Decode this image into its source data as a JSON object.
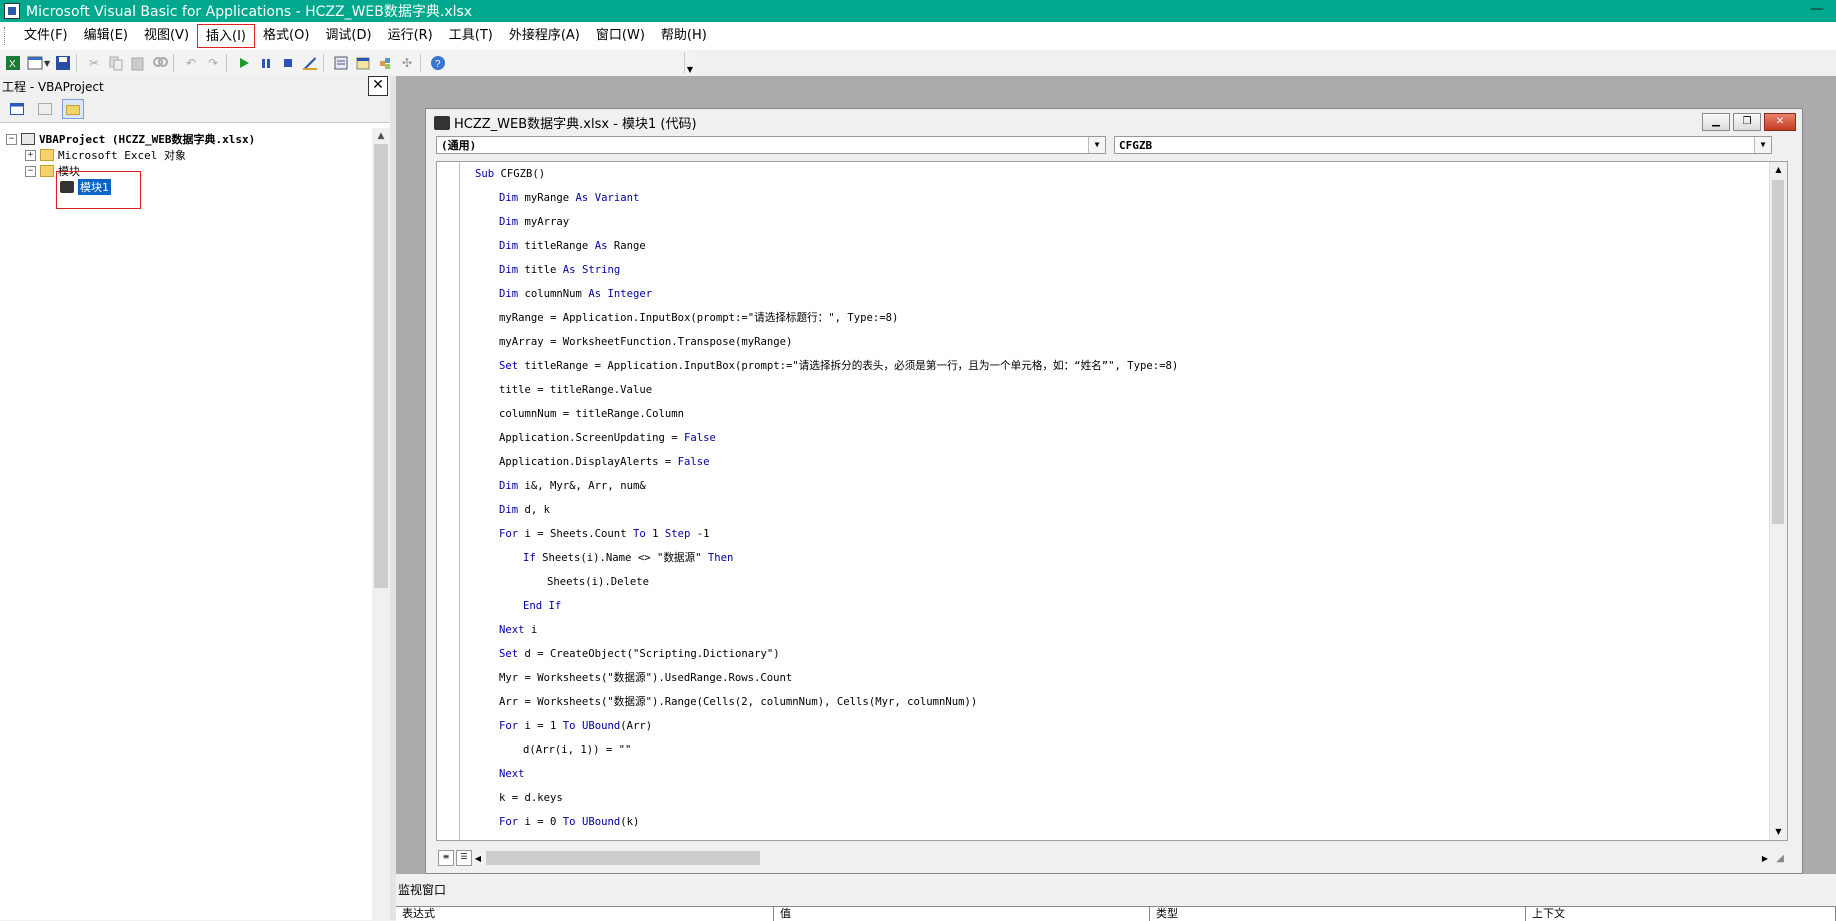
{
  "window": {
    "title": "Microsoft Visual Basic for Applications - HCZZ_WEB数据字典.xlsx",
    "minimize_glyph": "—"
  },
  "menu": [
    {
      "label": "文件(F)"
    },
    {
      "label": "编辑(E)"
    },
    {
      "label": "视图(V)"
    },
    {
      "label": "插入(I)",
      "highlighted": true
    },
    {
      "label": "格式(O)"
    },
    {
      "label": "调试(D)"
    },
    {
      "label": "运行(R)"
    },
    {
      "label": "工具(T)"
    },
    {
      "label": "外接程序(A)"
    },
    {
      "label": "窗口(W)"
    },
    {
      "label": "帮助(H)"
    }
  ],
  "toolbar": {
    "icons": [
      "excel-icon",
      "insert-userform-icon",
      "save-icon",
      "cut-icon",
      "copy-icon",
      "paste-icon",
      "find-icon",
      "undo-icon",
      "redo-icon",
      "run-icon",
      "break-icon",
      "reset-icon",
      "design-mode-icon",
      "project-explorer-icon",
      "properties-icon",
      "object-browser-icon",
      "toolbox-icon",
      "help-icon"
    ]
  },
  "project": {
    "title": "工程 - VBAProject",
    "close_glyph": "✕",
    "tree": {
      "root": "VBAProject (HCZZ_WEB数据字典.xlsx)",
      "excel_objects": "Microsoft Excel 对象",
      "modules_folder": "模块",
      "module1": "模块1"
    }
  },
  "codewindow": {
    "title": "HCZZ_WEB数据字典.xlsx - 模块1 (代码)",
    "object_dropdown": "(通用)",
    "proc_dropdown": "CFGZB",
    "lines": [
      {
        "indent": 0,
        "parts": [
          {
            "t": "Sub",
            "kw": true
          },
          {
            "t": " CFGZB()"
          }
        ]
      },
      {
        "indent": 1,
        "parts": [
          {
            "t": "Dim",
            "kw": true
          },
          {
            "t": " myRange "
          },
          {
            "t": "As",
            "kw": true
          },
          {
            "t": " "
          },
          {
            "t": "Variant",
            "kw": true
          }
        ]
      },
      {
        "indent": 1,
        "parts": [
          {
            "t": "Dim",
            "kw": true
          },
          {
            "t": " myArray"
          }
        ]
      },
      {
        "indent": 1,
        "parts": [
          {
            "t": "Dim",
            "kw": true
          },
          {
            "t": " titleRange "
          },
          {
            "t": "As",
            "kw": true
          },
          {
            "t": " Range"
          }
        ]
      },
      {
        "indent": 1,
        "parts": [
          {
            "t": "Dim",
            "kw": true
          },
          {
            "t": " title "
          },
          {
            "t": "As",
            "kw": true
          },
          {
            "t": " "
          },
          {
            "t": "String",
            "kw": true
          }
        ]
      },
      {
        "indent": 1,
        "parts": [
          {
            "t": "Dim",
            "kw": true
          },
          {
            "t": " columnNum "
          },
          {
            "t": "As",
            "kw": true
          },
          {
            "t": " "
          },
          {
            "t": "Integer",
            "kw": true
          }
        ]
      },
      {
        "indent": 1,
        "parts": [
          {
            "t": "myRange = Application.InputBox(prompt:=\"请选择标题行：\", Type:=8)"
          }
        ]
      },
      {
        "indent": 1,
        "parts": [
          {
            "t": "myArray = WorksheetFunction.Transpose(myRange)"
          }
        ]
      },
      {
        "indent": 1,
        "parts": [
          {
            "t": "Set",
            "kw": true
          },
          {
            "t": " titleRange = Application.InputBox(prompt:=\"请选择拆分的表头，必须是第一行，且为一个单元格，如：“姓名”\", Type:=8)"
          }
        ]
      },
      {
        "indent": 1,
        "parts": [
          {
            "t": "title = titleRange.Value"
          }
        ]
      },
      {
        "indent": 1,
        "parts": [
          {
            "t": "columnNum = titleRange.Column"
          }
        ]
      },
      {
        "indent": 1,
        "parts": [
          {
            "t": "Application.ScreenUpdating = "
          },
          {
            "t": "False",
            "kw": true
          }
        ]
      },
      {
        "indent": 1,
        "parts": [
          {
            "t": "Application.DisplayAlerts = "
          },
          {
            "t": "False",
            "kw": true
          }
        ]
      },
      {
        "indent": 1,
        "parts": [
          {
            "t": "Dim",
            "kw": true
          },
          {
            "t": " i&, Myr&, Arr, num&"
          }
        ]
      },
      {
        "indent": 1,
        "parts": [
          {
            "t": "Dim",
            "kw": true
          },
          {
            "t": " d, k"
          }
        ]
      },
      {
        "indent": 1,
        "parts": [
          {
            "t": "For",
            "kw": true
          },
          {
            "t": " i = Sheets.Count "
          },
          {
            "t": "To",
            "kw": true
          },
          {
            "t": " 1 "
          },
          {
            "t": "Step",
            "kw": true
          },
          {
            "t": " -1"
          }
        ]
      },
      {
        "indent": 2,
        "parts": [
          {
            "t": "If",
            "kw": true
          },
          {
            "t": " Sheets(i).Name <> \"数据源\" "
          },
          {
            "t": "Then",
            "kw": true
          }
        ]
      },
      {
        "indent": 3,
        "parts": [
          {
            "t": "Sheets(i).Delete"
          }
        ]
      },
      {
        "indent": 2,
        "parts": [
          {
            "t": "End If",
            "kw": true
          }
        ]
      },
      {
        "indent": 1,
        "parts": [
          {
            "t": "Next",
            "kw": true
          },
          {
            "t": " i"
          }
        ]
      },
      {
        "indent": 1,
        "parts": [
          {
            "t": "Set",
            "kw": true
          },
          {
            "t": " d = CreateObject(\"Scripting.Dictionary\")"
          }
        ]
      },
      {
        "indent": 1,
        "parts": [
          {
            "t": "Myr = Worksheets(\"数据源\").UsedRange.Rows.Count"
          }
        ]
      },
      {
        "indent": 1,
        "parts": [
          {
            "t": "Arr = Worksheets(\"数据源\").Range(Cells(2, columnNum), Cells(Myr, columnNum))"
          }
        ]
      },
      {
        "indent": 1,
        "parts": [
          {
            "t": "For",
            "kw": true
          },
          {
            "t": " i = 1 "
          },
          {
            "t": "To",
            "kw": true
          },
          {
            "t": " "
          },
          {
            "t": "UBound",
            "kw": true
          },
          {
            "t": "(Arr)"
          }
        ]
      },
      {
        "indent": 2,
        "parts": [
          {
            "t": "d(Arr(i, 1)) = \"\""
          }
        ]
      },
      {
        "indent": 1,
        "parts": [
          {
            "t": "Next",
            "kw": true
          }
        ]
      },
      {
        "indent": 1,
        "parts": [
          {
            "t": "k = d.keys"
          }
        ]
      },
      {
        "indent": 1,
        "parts": [
          {
            "t": "For",
            "kw": true
          },
          {
            "t": " i = 0 "
          },
          {
            "t": "To",
            "kw": true
          },
          {
            "t": " "
          },
          {
            "t": "UBound",
            "kw": true
          },
          {
            "t": "(k)"
          }
        ]
      }
    ]
  },
  "watch": {
    "title": "监视窗口",
    "columns": [
      "表达式",
      "值",
      "类型",
      "上下文"
    ]
  },
  "colors": {
    "titlebar": "#00a98e",
    "keyword": "#0000a0",
    "selection": "#0a64c8",
    "highlight_box": "#e02020"
  }
}
